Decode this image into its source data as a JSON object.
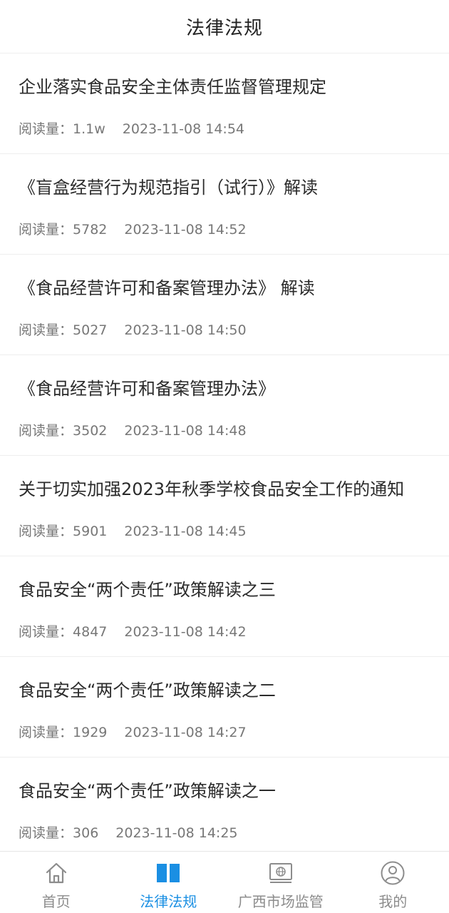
{
  "header": {
    "title": "法律法规"
  },
  "meta_prefix": "阅读量：",
  "articles": [
    {
      "title": "企业落实食品安全主体责任监督管理规定",
      "reads": "1.1w",
      "time": "2023-11-08 14:54"
    },
    {
      "title": "《盲盒经营行为规范指引（试行）》解读",
      "reads": "5782",
      "time": "2023-11-08 14:52"
    },
    {
      "title": "《食品经营许可和备案管理办法》 解读",
      "reads": "5027",
      "time": "2023-11-08 14:50"
    },
    {
      "title": "《食品经营许可和备案管理办法》",
      "reads": "3502",
      "time": "2023-11-08 14:48"
    },
    {
      "title": "关于切实加强2023年秋季学校食品安全工作的通知",
      "reads": "5901",
      "time": "2023-11-08 14:45"
    },
    {
      "title": "食品安全“两个责任”政策解读之三",
      "reads": "4847",
      "time": "2023-11-08 14:42"
    },
    {
      "title": "食品安全“两个责任”政策解读之二",
      "reads": "1929",
      "time": "2023-11-08 14:27"
    },
    {
      "title": "食品安全“两个责任”政策解读之一",
      "reads": "306",
      "time": "2023-11-08 14:25"
    }
  ],
  "tabbar": {
    "tabs": [
      {
        "label": "首页",
        "icon": "home-icon",
        "active": false
      },
      {
        "label": "法律法规",
        "icon": "book-icon",
        "active": true
      },
      {
        "label": "广西市场监管",
        "icon": "monitor-globe-icon",
        "active": false
      },
      {
        "label": "我的",
        "icon": "user-icon",
        "active": false
      }
    ]
  },
  "colors": {
    "accent": "#1a8fe3",
    "inactive": "#8c8c8c"
  }
}
